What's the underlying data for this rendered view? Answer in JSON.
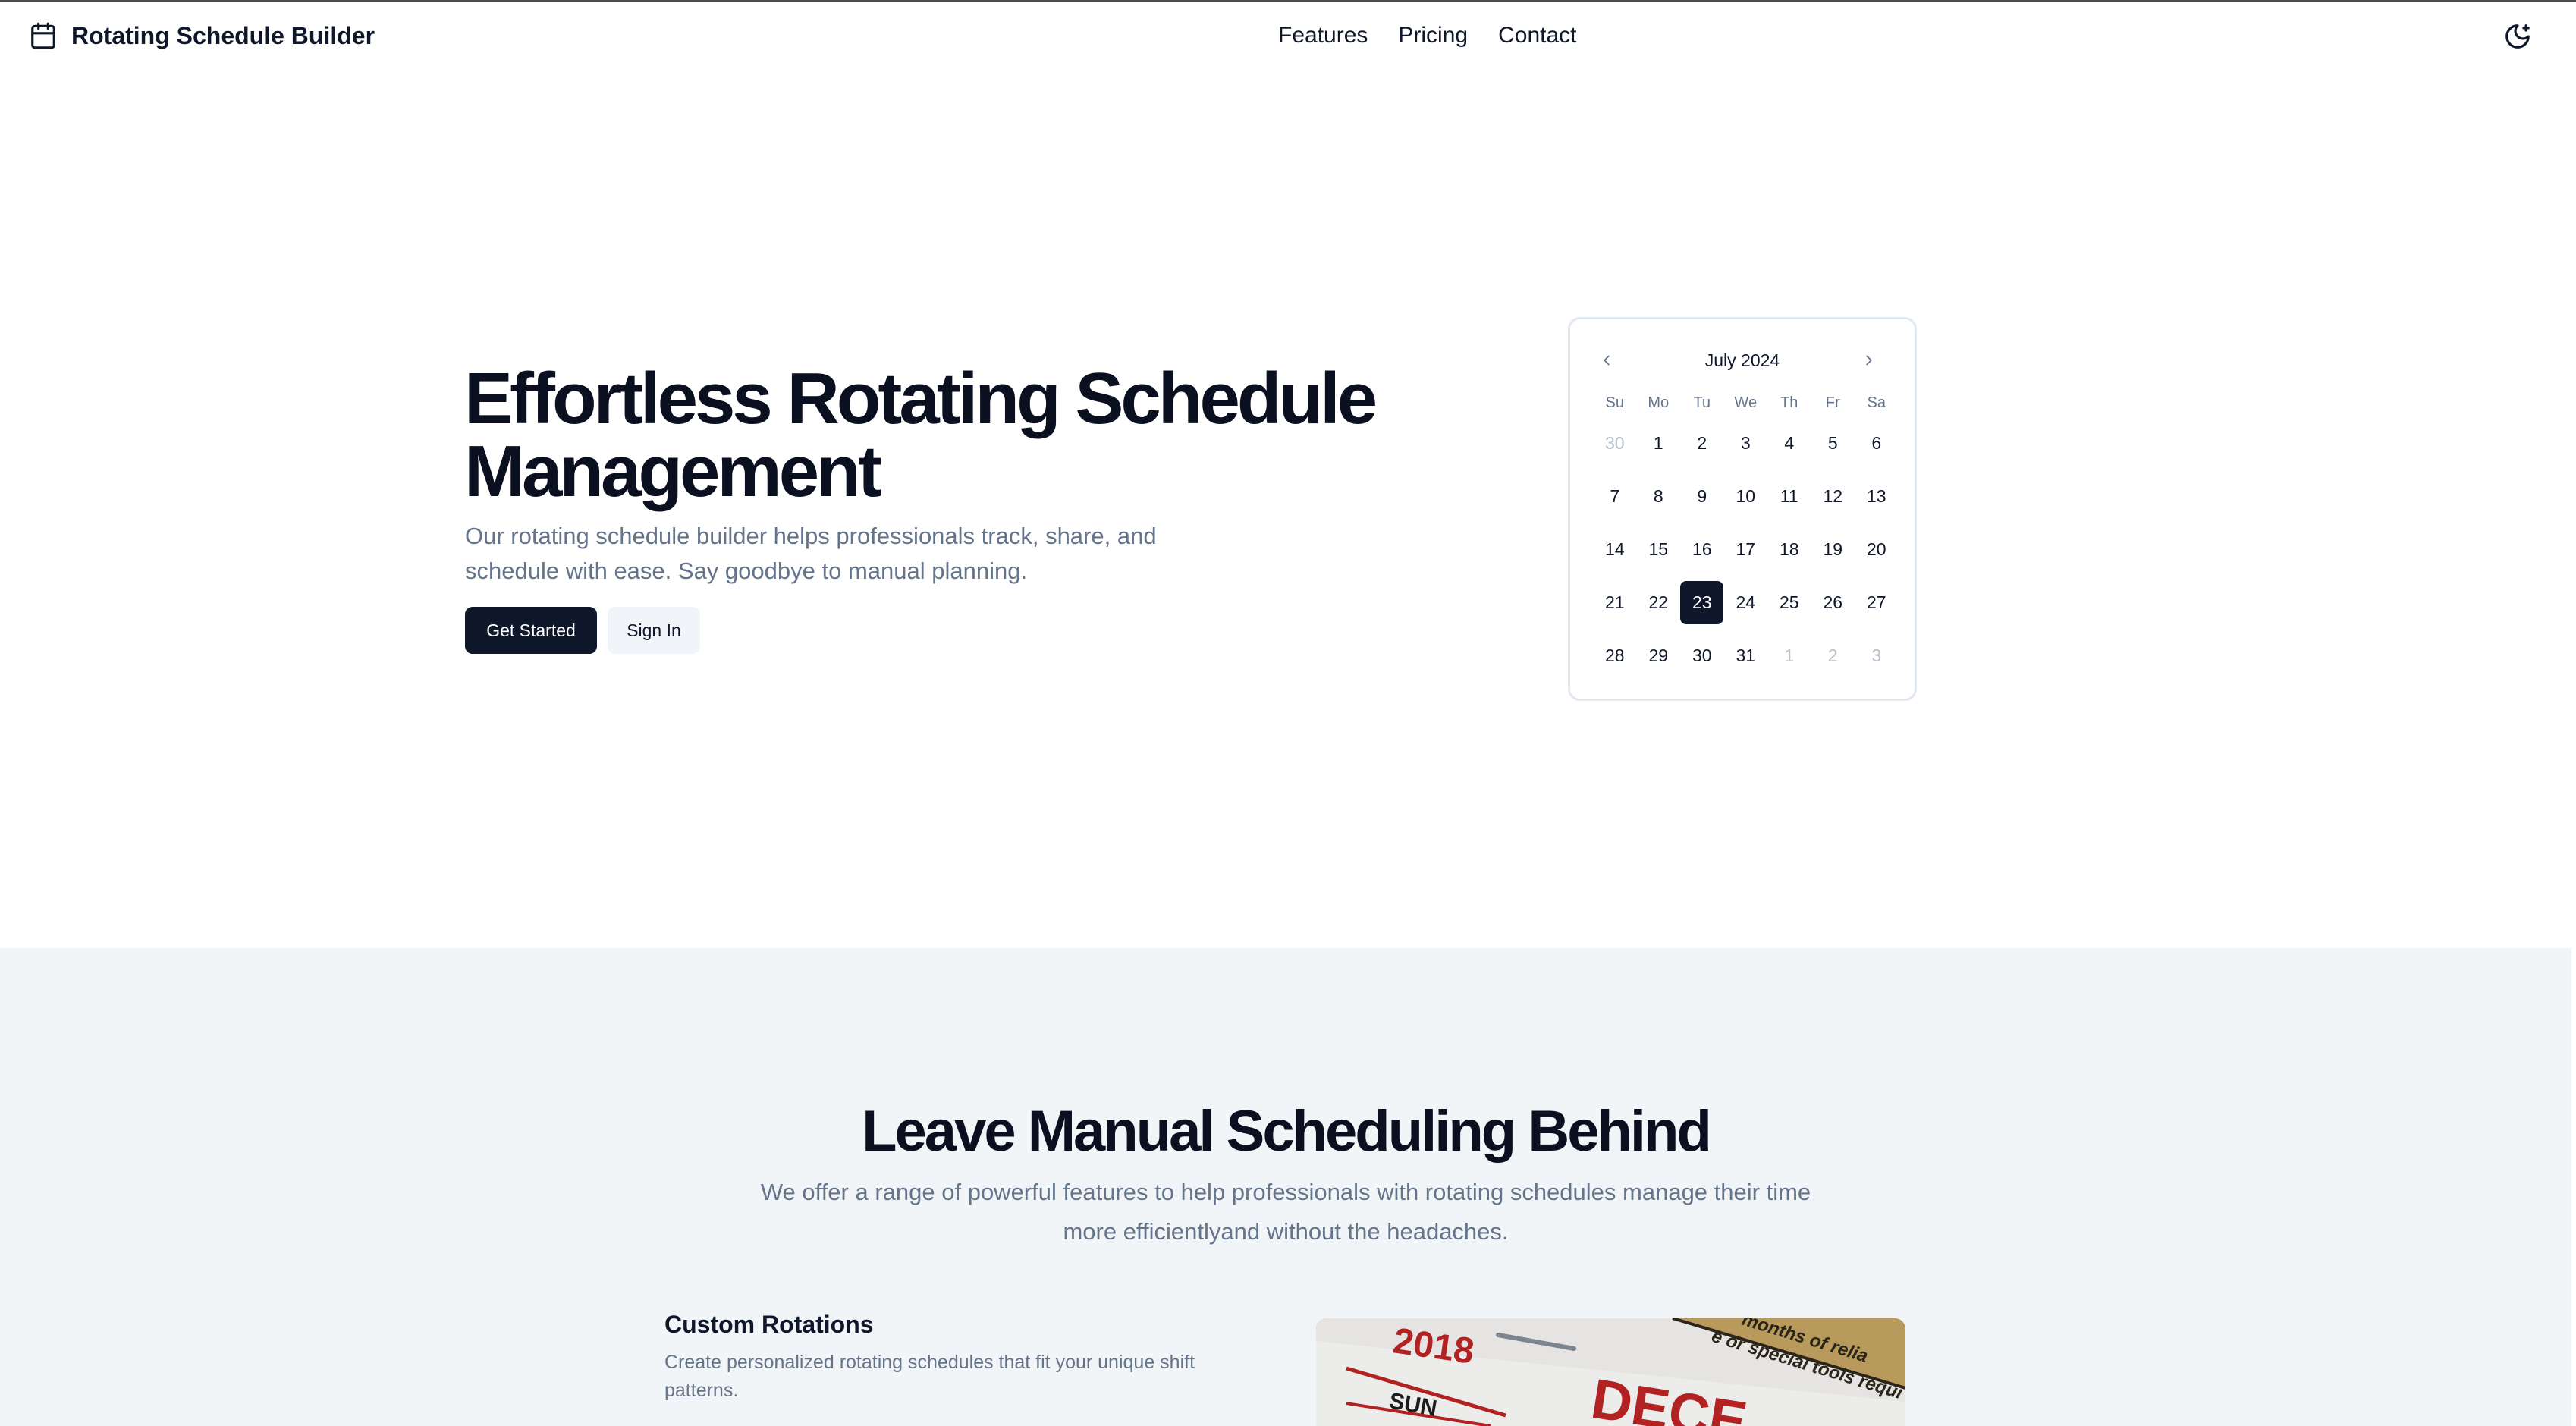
{
  "header": {
    "brand": "Rotating Schedule Builder",
    "brand_icon": "calendar-icon",
    "nav": [
      "Features",
      "Pricing",
      "Contact"
    ],
    "theme_icon": "moon-icon"
  },
  "hero": {
    "title": "Effortless Rotating Schedule Management",
    "description": "Our rotating schedule builder helps professionals track, share, and schedule with ease. Say goodbye to manual planning.",
    "primary_button": "Get Started",
    "secondary_button": "Sign In"
  },
  "calendar": {
    "month_label": "July 2024",
    "weekdays": [
      "Su",
      "Mo",
      "Tu",
      "We",
      "Th",
      "Fr",
      "Sa"
    ],
    "days": [
      {
        "label": "30",
        "muted": true
      },
      {
        "label": "1"
      },
      {
        "label": "2"
      },
      {
        "label": "3"
      },
      {
        "label": "4"
      },
      {
        "label": "5"
      },
      {
        "label": "6"
      },
      {
        "label": "7"
      },
      {
        "label": "8"
      },
      {
        "label": "9"
      },
      {
        "label": "10"
      },
      {
        "label": "11"
      },
      {
        "label": "12"
      },
      {
        "label": "13"
      },
      {
        "label": "14"
      },
      {
        "label": "15"
      },
      {
        "label": "16"
      },
      {
        "label": "17"
      },
      {
        "label": "18"
      },
      {
        "label": "19"
      },
      {
        "label": "20"
      },
      {
        "label": "21"
      },
      {
        "label": "22"
      },
      {
        "label": "23",
        "selected": true
      },
      {
        "label": "24"
      },
      {
        "label": "25"
      },
      {
        "label": "26"
      },
      {
        "label": "27"
      },
      {
        "label": "28"
      },
      {
        "label": "29"
      },
      {
        "label": "30"
      },
      {
        "label": "31"
      },
      {
        "label": "1",
        "muted": true
      },
      {
        "label": "2",
        "muted": true
      },
      {
        "label": "3",
        "muted": true
      }
    ]
  },
  "features": {
    "title": "Leave Manual Scheduling Behind",
    "description": "We offer a range of powerful features to help professionals with rotating schedules manage their time more efficientlyand without the headaches.",
    "item_title": "Custom Rotations",
    "item_description": "Create personalized rotating schedules that fit your unique shift patterns."
  },
  "feature_image": {
    "year": "2018",
    "weekday": "SUN",
    "month_fragment": "DECE",
    "note": "months of relia",
    "note2": "e or special tools requi"
  },
  "colors": {
    "primary": "#0f172a",
    "muted_text": "#64748b",
    "section_bg": "#f2f5f7"
  }
}
